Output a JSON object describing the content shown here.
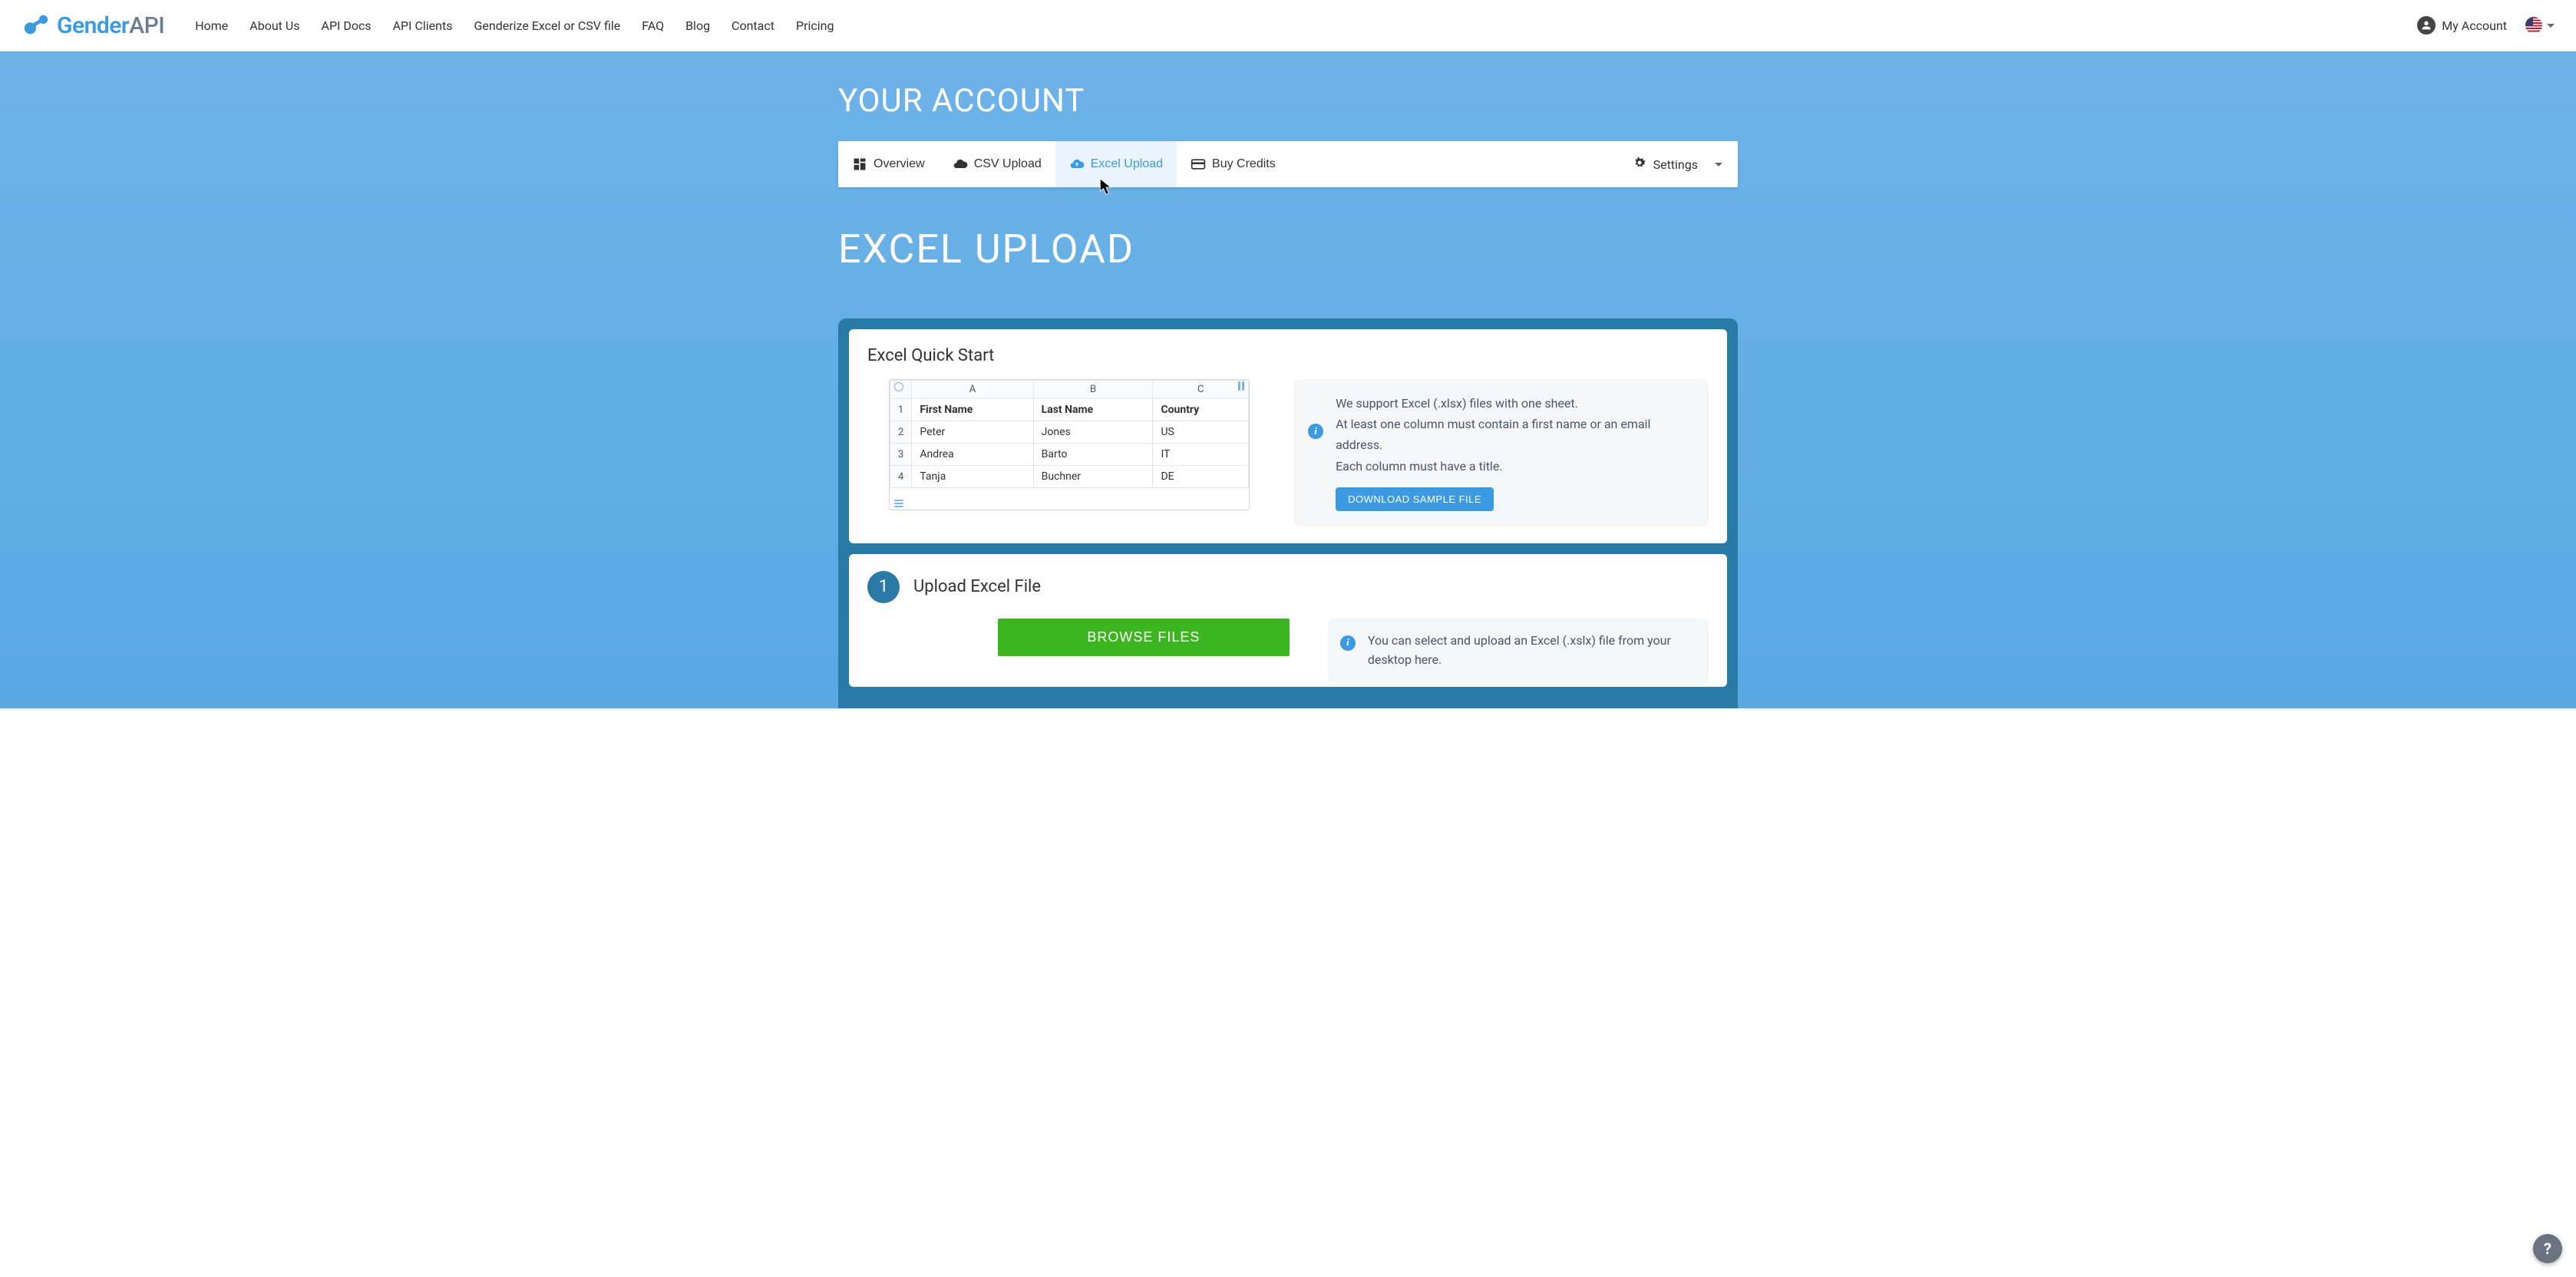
{
  "header": {
    "logo_prefix": "Gender",
    "logo_suffix": "API",
    "nav": [
      "Home",
      "About Us",
      "API Docs",
      "API Clients",
      "Genderize Excel or CSV file",
      "FAQ",
      "Blog",
      "Contact",
      "Pricing"
    ],
    "account_label": "My Account"
  },
  "page": {
    "title": "YOUR ACCOUNT",
    "section_title": "EXCEL UPLOAD"
  },
  "tabs": {
    "overview": "Overview",
    "csv_upload": "CSV Upload",
    "excel_upload": "Excel Upload",
    "buy_credits": "Buy Credits",
    "settings": "Settings"
  },
  "quickstart": {
    "title": "Excel Quick Start",
    "sheet": {
      "col_letters": [
        "A",
        "B",
        "C"
      ],
      "headers": [
        "First Name",
        "Last Name",
        "Country"
      ],
      "rows": [
        {
          "n": "1",
          "c": [
            "First Name",
            "Last Name",
            "Country"
          ]
        },
        {
          "n": "2",
          "c": [
            "Peter",
            "Jones",
            "US"
          ]
        },
        {
          "n": "3",
          "c": [
            "Andrea",
            "Barto",
            "IT"
          ]
        },
        {
          "n": "4",
          "c": [
            "Tanja",
            "Buchner",
            "DE"
          ]
        }
      ]
    },
    "info_line1": "We support Excel (.xlsx) files with one sheet.",
    "info_line2": "At least one column must contain a first name or an email address.",
    "info_line3": "Each column must have a title.",
    "download_label": "DOWNLOAD SAMPLE FILE"
  },
  "step1": {
    "number": "1",
    "title": "Upload Excel File",
    "browse_label": "BROWSE FILES",
    "info": "You can select and upload an Excel (.xslx) file from your desktop here."
  },
  "help": "?"
}
